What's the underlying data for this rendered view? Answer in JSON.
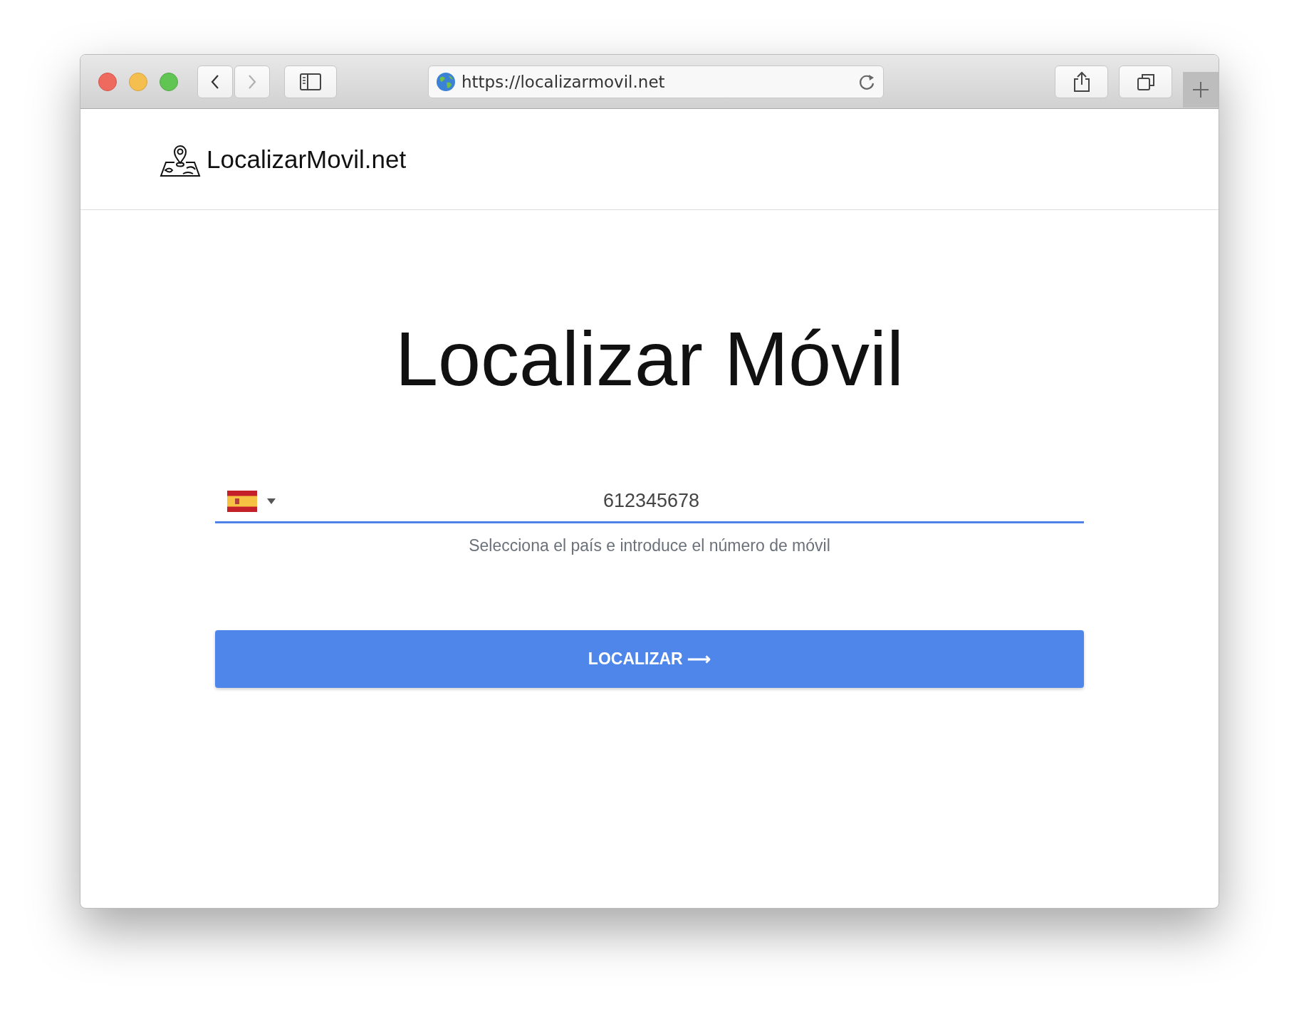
{
  "browser": {
    "url": "https://localizarmovil.net",
    "nav": [
      {
        "kind": "back",
        "disabled": false
      },
      {
        "kind": "forward",
        "disabled": true
      }
    ]
  },
  "site": {
    "brand": "LocalizarMovil.net"
  },
  "hero": {
    "title": "Localizar Móvil"
  },
  "phone_field": {
    "value": "612345678",
    "hint": "Selecciona el país e introduce el número de móvil"
  },
  "submit": {
    "label": "LOCALIZAR",
    "arrow": "⟶"
  }
}
